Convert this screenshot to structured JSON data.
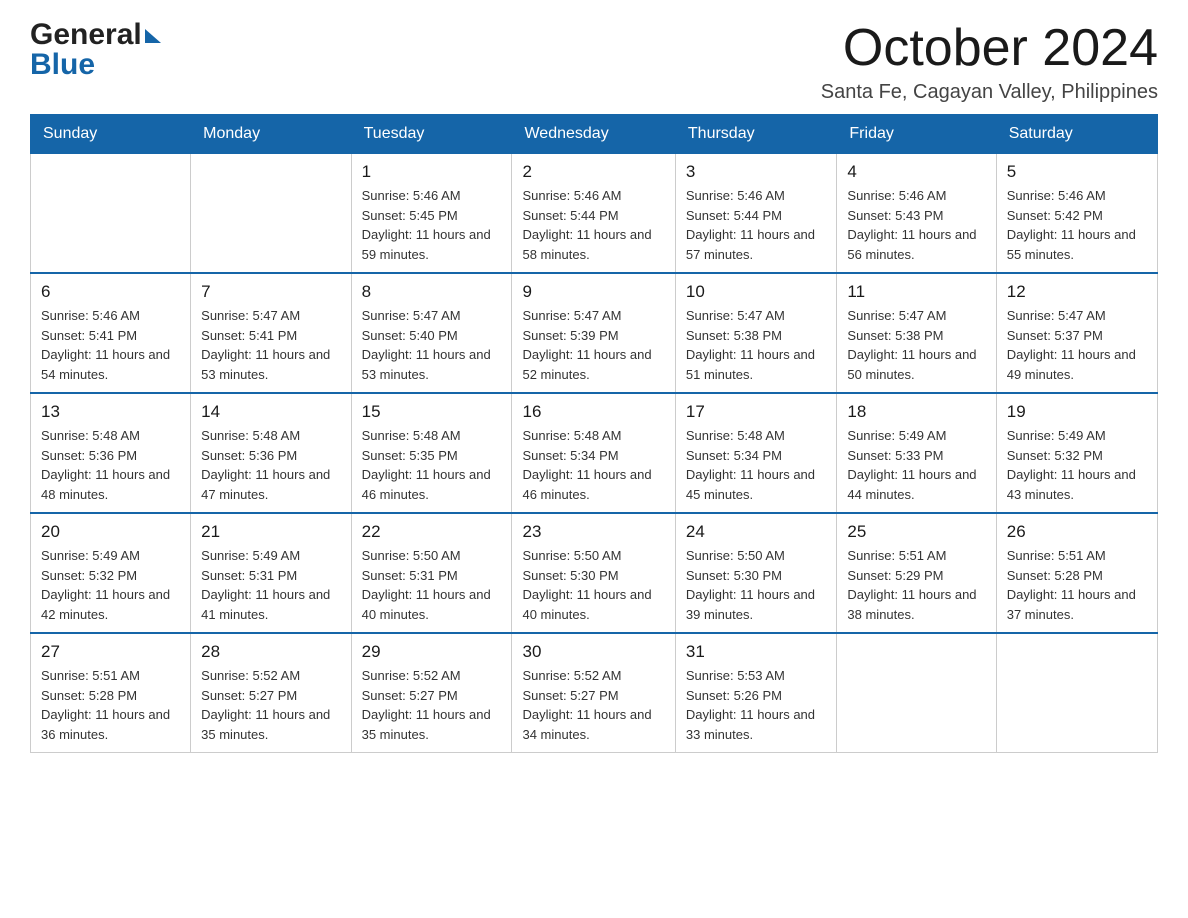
{
  "header": {
    "logo_general": "General",
    "logo_blue": "Blue",
    "month_title": "October 2024",
    "location": "Santa Fe, Cagayan Valley, Philippines"
  },
  "calendar": {
    "days_of_week": [
      "Sunday",
      "Monday",
      "Tuesday",
      "Wednesday",
      "Thursday",
      "Friday",
      "Saturday"
    ],
    "weeks": [
      [
        {
          "day": "",
          "sunrise": "",
          "sunset": "",
          "daylight": ""
        },
        {
          "day": "",
          "sunrise": "",
          "sunset": "",
          "daylight": ""
        },
        {
          "day": "1",
          "sunrise": "5:46 AM",
          "sunset": "5:45 PM",
          "daylight": "11 hours and 59 minutes."
        },
        {
          "day": "2",
          "sunrise": "5:46 AM",
          "sunset": "5:44 PM",
          "daylight": "11 hours and 58 minutes."
        },
        {
          "day": "3",
          "sunrise": "5:46 AM",
          "sunset": "5:44 PM",
          "daylight": "11 hours and 57 minutes."
        },
        {
          "day": "4",
          "sunrise": "5:46 AM",
          "sunset": "5:43 PM",
          "daylight": "11 hours and 56 minutes."
        },
        {
          "day": "5",
          "sunrise": "5:46 AM",
          "sunset": "5:42 PM",
          "daylight": "11 hours and 55 minutes."
        }
      ],
      [
        {
          "day": "6",
          "sunrise": "5:46 AM",
          "sunset": "5:41 PM",
          "daylight": "11 hours and 54 minutes."
        },
        {
          "day": "7",
          "sunrise": "5:47 AM",
          "sunset": "5:41 PM",
          "daylight": "11 hours and 53 minutes."
        },
        {
          "day": "8",
          "sunrise": "5:47 AM",
          "sunset": "5:40 PM",
          "daylight": "11 hours and 53 minutes."
        },
        {
          "day": "9",
          "sunrise": "5:47 AM",
          "sunset": "5:39 PM",
          "daylight": "11 hours and 52 minutes."
        },
        {
          "day": "10",
          "sunrise": "5:47 AM",
          "sunset": "5:38 PM",
          "daylight": "11 hours and 51 minutes."
        },
        {
          "day": "11",
          "sunrise": "5:47 AM",
          "sunset": "5:38 PM",
          "daylight": "11 hours and 50 minutes."
        },
        {
          "day": "12",
          "sunrise": "5:47 AM",
          "sunset": "5:37 PM",
          "daylight": "11 hours and 49 minutes."
        }
      ],
      [
        {
          "day": "13",
          "sunrise": "5:48 AM",
          "sunset": "5:36 PM",
          "daylight": "11 hours and 48 minutes."
        },
        {
          "day": "14",
          "sunrise": "5:48 AM",
          "sunset": "5:36 PM",
          "daylight": "11 hours and 47 minutes."
        },
        {
          "day": "15",
          "sunrise": "5:48 AM",
          "sunset": "5:35 PM",
          "daylight": "11 hours and 46 minutes."
        },
        {
          "day": "16",
          "sunrise": "5:48 AM",
          "sunset": "5:34 PM",
          "daylight": "11 hours and 46 minutes."
        },
        {
          "day": "17",
          "sunrise": "5:48 AM",
          "sunset": "5:34 PM",
          "daylight": "11 hours and 45 minutes."
        },
        {
          "day": "18",
          "sunrise": "5:49 AM",
          "sunset": "5:33 PM",
          "daylight": "11 hours and 44 minutes."
        },
        {
          "day": "19",
          "sunrise": "5:49 AM",
          "sunset": "5:32 PM",
          "daylight": "11 hours and 43 minutes."
        }
      ],
      [
        {
          "day": "20",
          "sunrise": "5:49 AM",
          "sunset": "5:32 PM",
          "daylight": "11 hours and 42 minutes."
        },
        {
          "day": "21",
          "sunrise": "5:49 AM",
          "sunset": "5:31 PM",
          "daylight": "11 hours and 41 minutes."
        },
        {
          "day": "22",
          "sunrise": "5:50 AM",
          "sunset": "5:31 PM",
          "daylight": "11 hours and 40 minutes."
        },
        {
          "day": "23",
          "sunrise": "5:50 AM",
          "sunset": "5:30 PM",
          "daylight": "11 hours and 40 minutes."
        },
        {
          "day": "24",
          "sunrise": "5:50 AM",
          "sunset": "5:30 PM",
          "daylight": "11 hours and 39 minutes."
        },
        {
          "day": "25",
          "sunrise": "5:51 AM",
          "sunset": "5:29 PM",
          "daylight": "11 hours and 38 minutes."
        },
        {
          "day": "26",
          "sunrise": "5:51 AM",
          "sunset": "5:28 PM",
          "daylight": "11 hours and 37 minutes."
        }
      ],
      [
        {
          "day": "27",
          "sunrise": "5:51 AM",
          "sunset": "5:28 PM",
          "daylight": "11 hours and 36 minutes."
        },
        {
          "day": "28",
          "sunrise": "5:52 AM",
          "sunset": "5:27 PM",
          "daylight": "11 hours and 35 minutes."
        },
        {
          "day": "29",
          "sunrise": "5:52 AM",
          "sunset": "5:27 PM",
          "daylight": "11 hours and 35 minutes."
        },
        {
          "day": "30",
          "sunrise": "5:52 AM",
          "sunset": "5:27 PM",
          "daylight": "11 hours and 34 minutes."
        },
        {
          "day": "31",
          "sunrise": "5:53 AM",
          "sunset": "5:26 PM",
          "daylight": "11 hours and 33 minutes."
        },
        {
          "day": "",
          "sunrise": "",
          "sunset": "",
          "daylight": ""
        },
        {
          "day": "",
          "sunrise": "",
          "sunset": "",
          "daylight": ""
        }
      ]
    ]
  }
}
